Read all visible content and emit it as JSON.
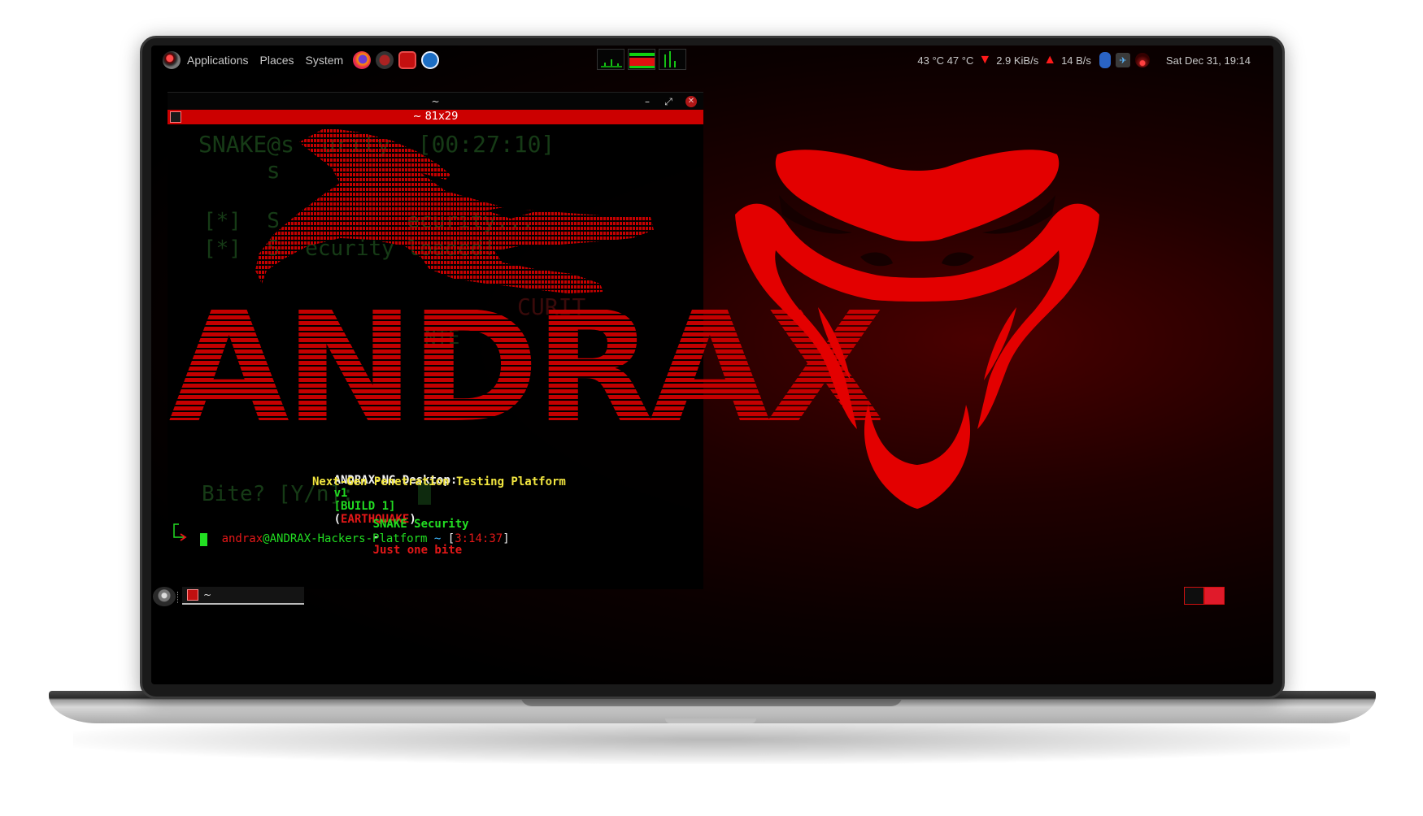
{
  "top_panel": {
    "menus": [
      "Applications",
      "Places",
      "System"
    ],
    "launchers": [
      "firefox-icon",
      "tool-icon",
      "terminal-icon",
      "browser-icon"
    ],
    "temps": "43 °C 47 °C",
    "download_speed": "2.9 KiB/s",
    "upload_speed": "14 B/s",
    "clock": "Sat Dec 31, 19:14"
  },
  "terminal": {
    "window_title": "~",
    "tab_title": "~ 81x29",
    "banner_line1": {
      "name": "ANDRAX-NG Desktop:",
      "version": "v1",
      "build": "[BUILD 1]",
      "paren_open": "(",
      "codename": "EARTHQUAKE",
      "paren_close": ")"
    },
    "banner_line2": "Next-Gen Penetration Testing Platform",
    "banner_line3": {
      "company": "SNAKE Security",
      "dash": "-",
      "motto": "Just one bite"
    },
    "prompt": {
      "user": "andrax",
      "host": "@ANDRAX-Hackers-Platform",
      "path": "~",
      "time_open": "[",
      "time": "3:14:37",
      "time_close": "]"
    },
    "ghost_text": {
      "line1": "SNAKE@s  urity  [00:27:10]",
      "line2": "  s",
      "line3": "[*]  S          ecurity...",
      "line4": "[*]  S  ecurity loaded!",
      "line5": "CURIT",
      "line6": "NTE",
      "line7": "Bite? [Y/n]:"
    },
    "ascii_word": "ANDRAX"
  },
  "bottom_panel": {
    "task_label": "~"
  },
  "colors": {
    "accent_red": "#cc0000",
    "terminal_green": "#22dd22",
    "terminal_yellow": "#f2e640"
  }
}
